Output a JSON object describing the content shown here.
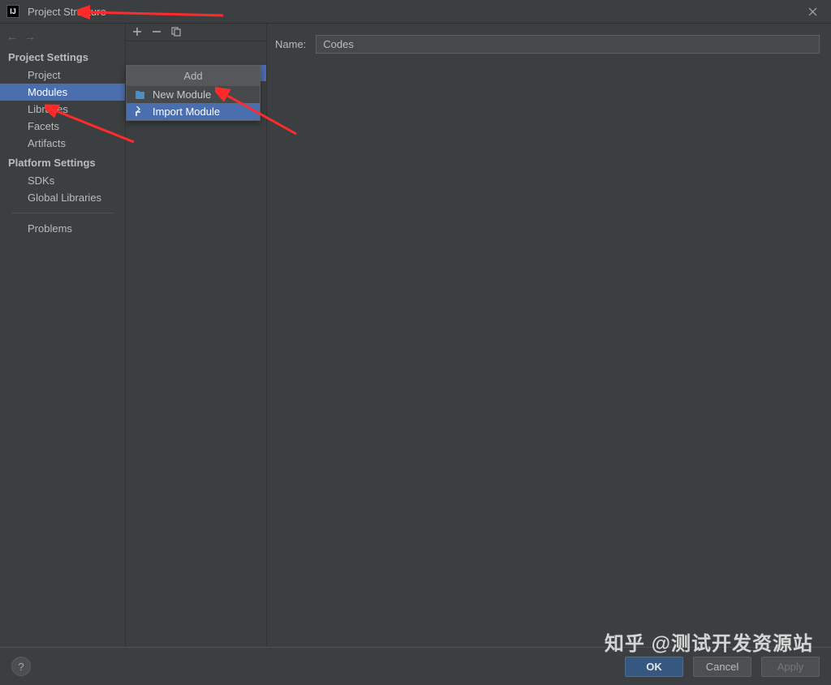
{
  "titlebar": {
    "title": "Project Structure"
  },
  "sidebar": {
    "section1": "Project Settings",
    "items1": [
      "Project",
      "Modules",
      "Libraries",
      "Facets",
      "Artifacts"
    ],
    "selected1": 1,
    "section2": "Platform Settings",
    "items2": [
      "SDKs",
      "Global Libraries"
    ],
    "problems": "Problems"
  },
  "popup": {
    "header": "Add",
    "items": [
      {
        "icon": "new-module-icon",
        "label": "New Module"
      },
      {
        "icon": "import-module-icon",
        "label": "Import Module"
      }
    ],
    "highlight": 1
  },
  "rightPanel": {
    "nameLabel": "Name:",
    "nameValue": "Codes"
  },
  "buttons": {
    "ok": "OK",
    "cancel": "Cancel",
    "apply": "Apply"
  },
  "watermark": "知乎 @测试开发资源站"
}
